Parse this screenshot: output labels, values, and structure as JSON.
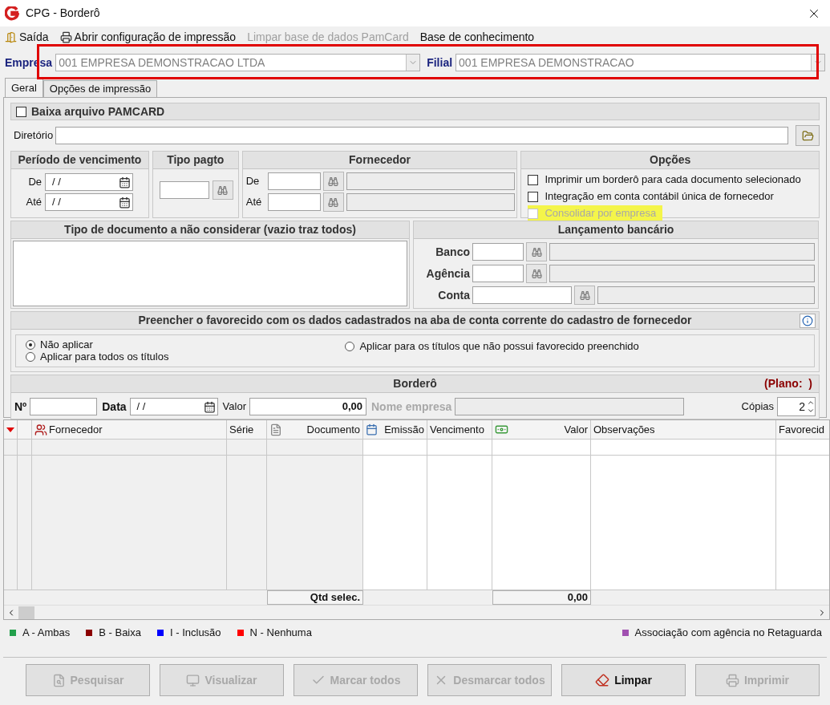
{
  "window": {
    "title": "CPG - Borderô"
  },
  "menu": [
    {
      "label": "Saída",
      "kind": "exit",
      "disabled": false
    },
    {
      "label": "Abrir configuração de impressão",
      "kind": "print",
      "disabled": false
    },
    {
      "label": "Limpar base de dados PamCard",
      "kind": "plain",
      "disabled": true
    },
    {
      "label": "Base de conhecimento",
      "kind": "plain",
      "disabled": false
    }
  ],
  "company_bar": {
    "highlighted": true,
    "empresa_label": "Empresa",
    "empresa_value": "001 EMPRESA DEMONSTRACAO LTDA",
    "filial_label": "Filial",
    "filial_value": "001 EMPRESA DEMONSTRACAO"
  },
  "tabs": [
    {
      "label": "Geral",
      "selected": true
    },
    {
      "label": "Opções de impressão",
      "selected": false
    }
  ],
  "pamcard": {
    "label": "Baixa arquivo PAMCARD",
    "checked": false,
    "directory_label": "Diretório"
  },
  "periodo": {
    "title": "Período de vencimento",
    "fields": [
      {
        "label": "De",
        "value": "/ /"
      },
      {
        "label": "Até",
        "value": "/ /"
      }
    ]
  },
  "tipo_pagto": {
    "title": "Tipo pagto"
  },
  "fornecedor": {
    "title": "Fornecedor",
    "fields": [
      {
        "label": "De"
      },
      {
        "label": "Até"
      }
    ]
  },
  "opcoes": {
    "title": "Opções",
    "items": [
      {
        "label": "Imprimir um borderô para cada documento selecionado",
        "checked": false,
        "disabled": false,
        "highlighted": false
      },
      {
        "label": "Integração em conta contábil única de fornecedor",
        "checked": false,
        "disabled": false,
        "highlighted": false
      },
      {
        "label": "Consolidar por empresa",
        "checked": false,
        "disabled": true,
        "highlighted": true
      }
    ]
  },
  "tipo_documento": {
    "title": "Tipo de documento a não considerar (vazio traz todos)"
  },
  "lancamento": {
    "title": "Lançamento bancário",
    "fields": [
      {
        "label": "Banco",
        "kind": "short"
      },
      {
        "label": "Agência",
        "kind": "short"
      },
      {
        "label": "Conta",
        "kind": "long"
      }
    ]
  },
  "favorecido": {
    "title": "Preencher o favorecido com os dados cadastrados na aba de conta corrente do cadastro de fornecedor",
    "options": [
      {
        "label": "Não aplicar",
        "selected": true
      },
      {
        "label": "Aplicar para todos os títulos",
        "selected": false
      },
      {
        "label": "Aplicar para os títulos que não possui favorecido preenchido",
        "selected": false
      }
    ]
  },
  "bordero": {
    "title": "Borderô",
    "plano": "(Plano:  )",
    "numero_label": "Nº",
    "data_label": "Data",
    "data_value": "/ /",
    "valor_label": "Valor",
    "valor_value": "0,00",
    "nome_empresa_label": "Nome empresa",
    "copias_label": "Cópias",
    "copias_value": "2"
  },
  "grid": {
    "columns": [
      {
        "kind": "sort"
      },
      {
        "kind": "plain"
      },
      {
        "label": "Fornecedor",
        "kind": "supplier"
      },
      {
        "label": "Série",
        "kind": "plain"
      },
      {
        "label": "Documento",
        "kind": "document"
      },
      {
        "label": "Emissão",
        "kind": "date"
      },
      {
        "label": "Vencimento",
        "kind": "plain"
      },
      {
        "label": "Valor",
        "kind": "money"
      },
      {
        "label": "Observações",
        "kind": "plain"
      },
      {
        "label": "Favorecid",
        "kind": "plain"
      }
    ],
    "qtd_label": "Qtd selec.",
    "total_value": "0,00"
  },
  "legend": [
    {
      "label": "A - Ambas",
      "color": "#22a04b"
    },
    {
      "label": "B - Baixa",
      "color": "#8b0000"
    },
    {
      "label": "I - Inclusão",
      "color": "#0000ff"
    },
    {
      "label": "N - Nenhuma",
      "color": "#ff0000"
    },
    {
      "label": "Associação com agência no Retaguarda",
      "color": "#a050b0"
    }
  ],
  "buttons": [
    {
      "label": "Pesquisar",
      "kind": "search",
      "disabled": true
    },
    {
      "label": "Visualizar",
      "kind": "preview",
      "disabled": true
    },
    {
      "label": "Marcar todos",
      "kind": "check",
      "disabled": true
    },
    {
      "label": "Desmarcar todos",
      "kind": "uncheck",
      "disabled": true
    },
    {
      "label": "Limpar",
      "kind": "clear",
      "disabled": false
    },
    {
      "label": "Imprimir",
      "kind": "print",
      "disabled": true
    }
  ]
}
